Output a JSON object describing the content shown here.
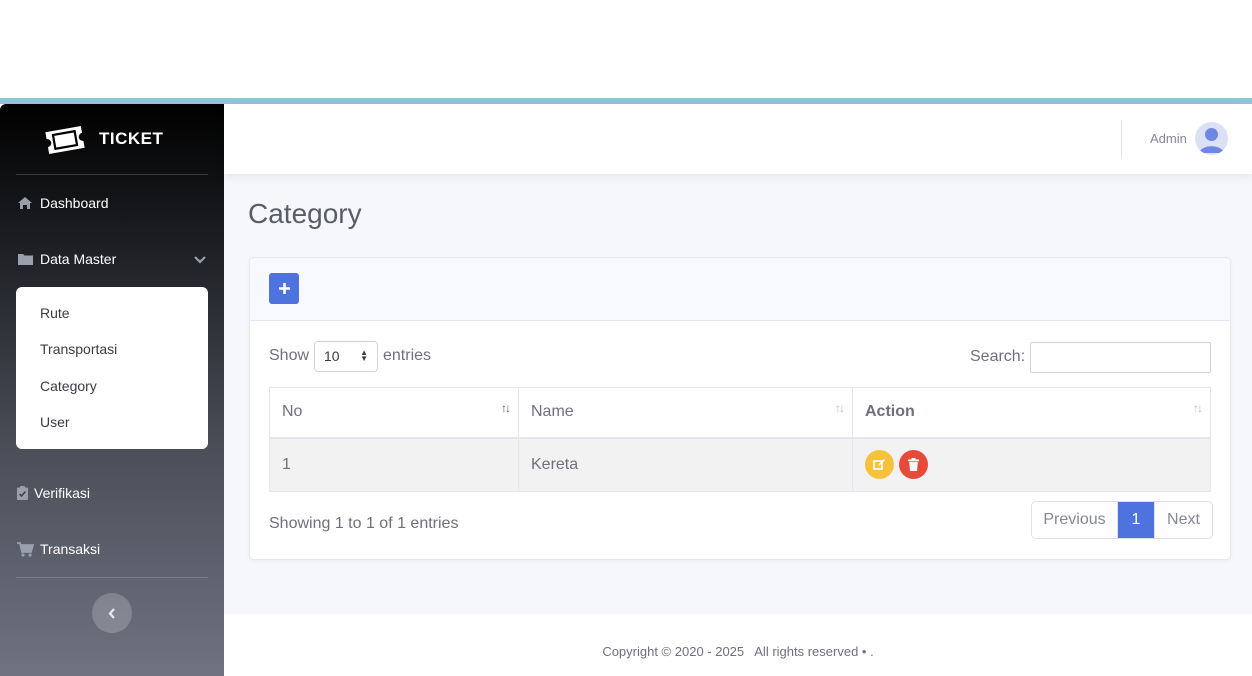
{
  "brand": {
    "name": "TICKET",
    "logo_icon": "ticket-icon"
  },
  "sidebar": {
    "items": [
      {
        "label": "Dashboard",
        "icon": "home-icon"
      },
      {
        "label": "Data Master",
        "icon": "folder-icon",
        "expanded": true
      },
      {
        "label": "Verifikasi",
        "icon": "clipboard-check-icon"
      },
      {
        "label": "Transaksi",
        "icon": "shopping-cart-icon"
      }
    ],
    "submenu": [
      {
        "label": "Rute"
      },
      {
        "label": "Transportasi"
      },
      {
        "label": "Category"
      },
      {
        "label": "User"
      }
    ],
    "toggle_icon": "chevron-left-icon"
  },
  "topbar": {
    "user_name": "Admin",
    "avatar_icon": "user-avatar-icon"
  },
  "page": {
    "title": "Category"
  },
  "card": {
    "add_icon": "plus-icon",
    "length": {
      "show_label": "Show",
      "value": "10",
      "entries_label": "entries"
    },
    "search": {
      "label": "Search:",
      "value": ""
    },
    "table": {
      "headers": [
        "No",
        "Name",
        "Action"
      ],
      "rows": [
        {
          "no": "1",
          "name": "Kereta"
        }
      ]
    },
    "info": "Showing 1 to 1 of 1 entries",
    "pagination": {
      "previous": "Previous",
      "current": "1",
      "next": "Next"
    }
  },
  "footer": {
    "text": "Copyright © 2020 - 2025   All rights reserved • ."
  },
  "colors": {
    "primary": "#4e73df",
    "warning": "#f6c23e",
    "danger": "#e74a3b",
    "accent_strip": "#8cc6d8"
  }
}
